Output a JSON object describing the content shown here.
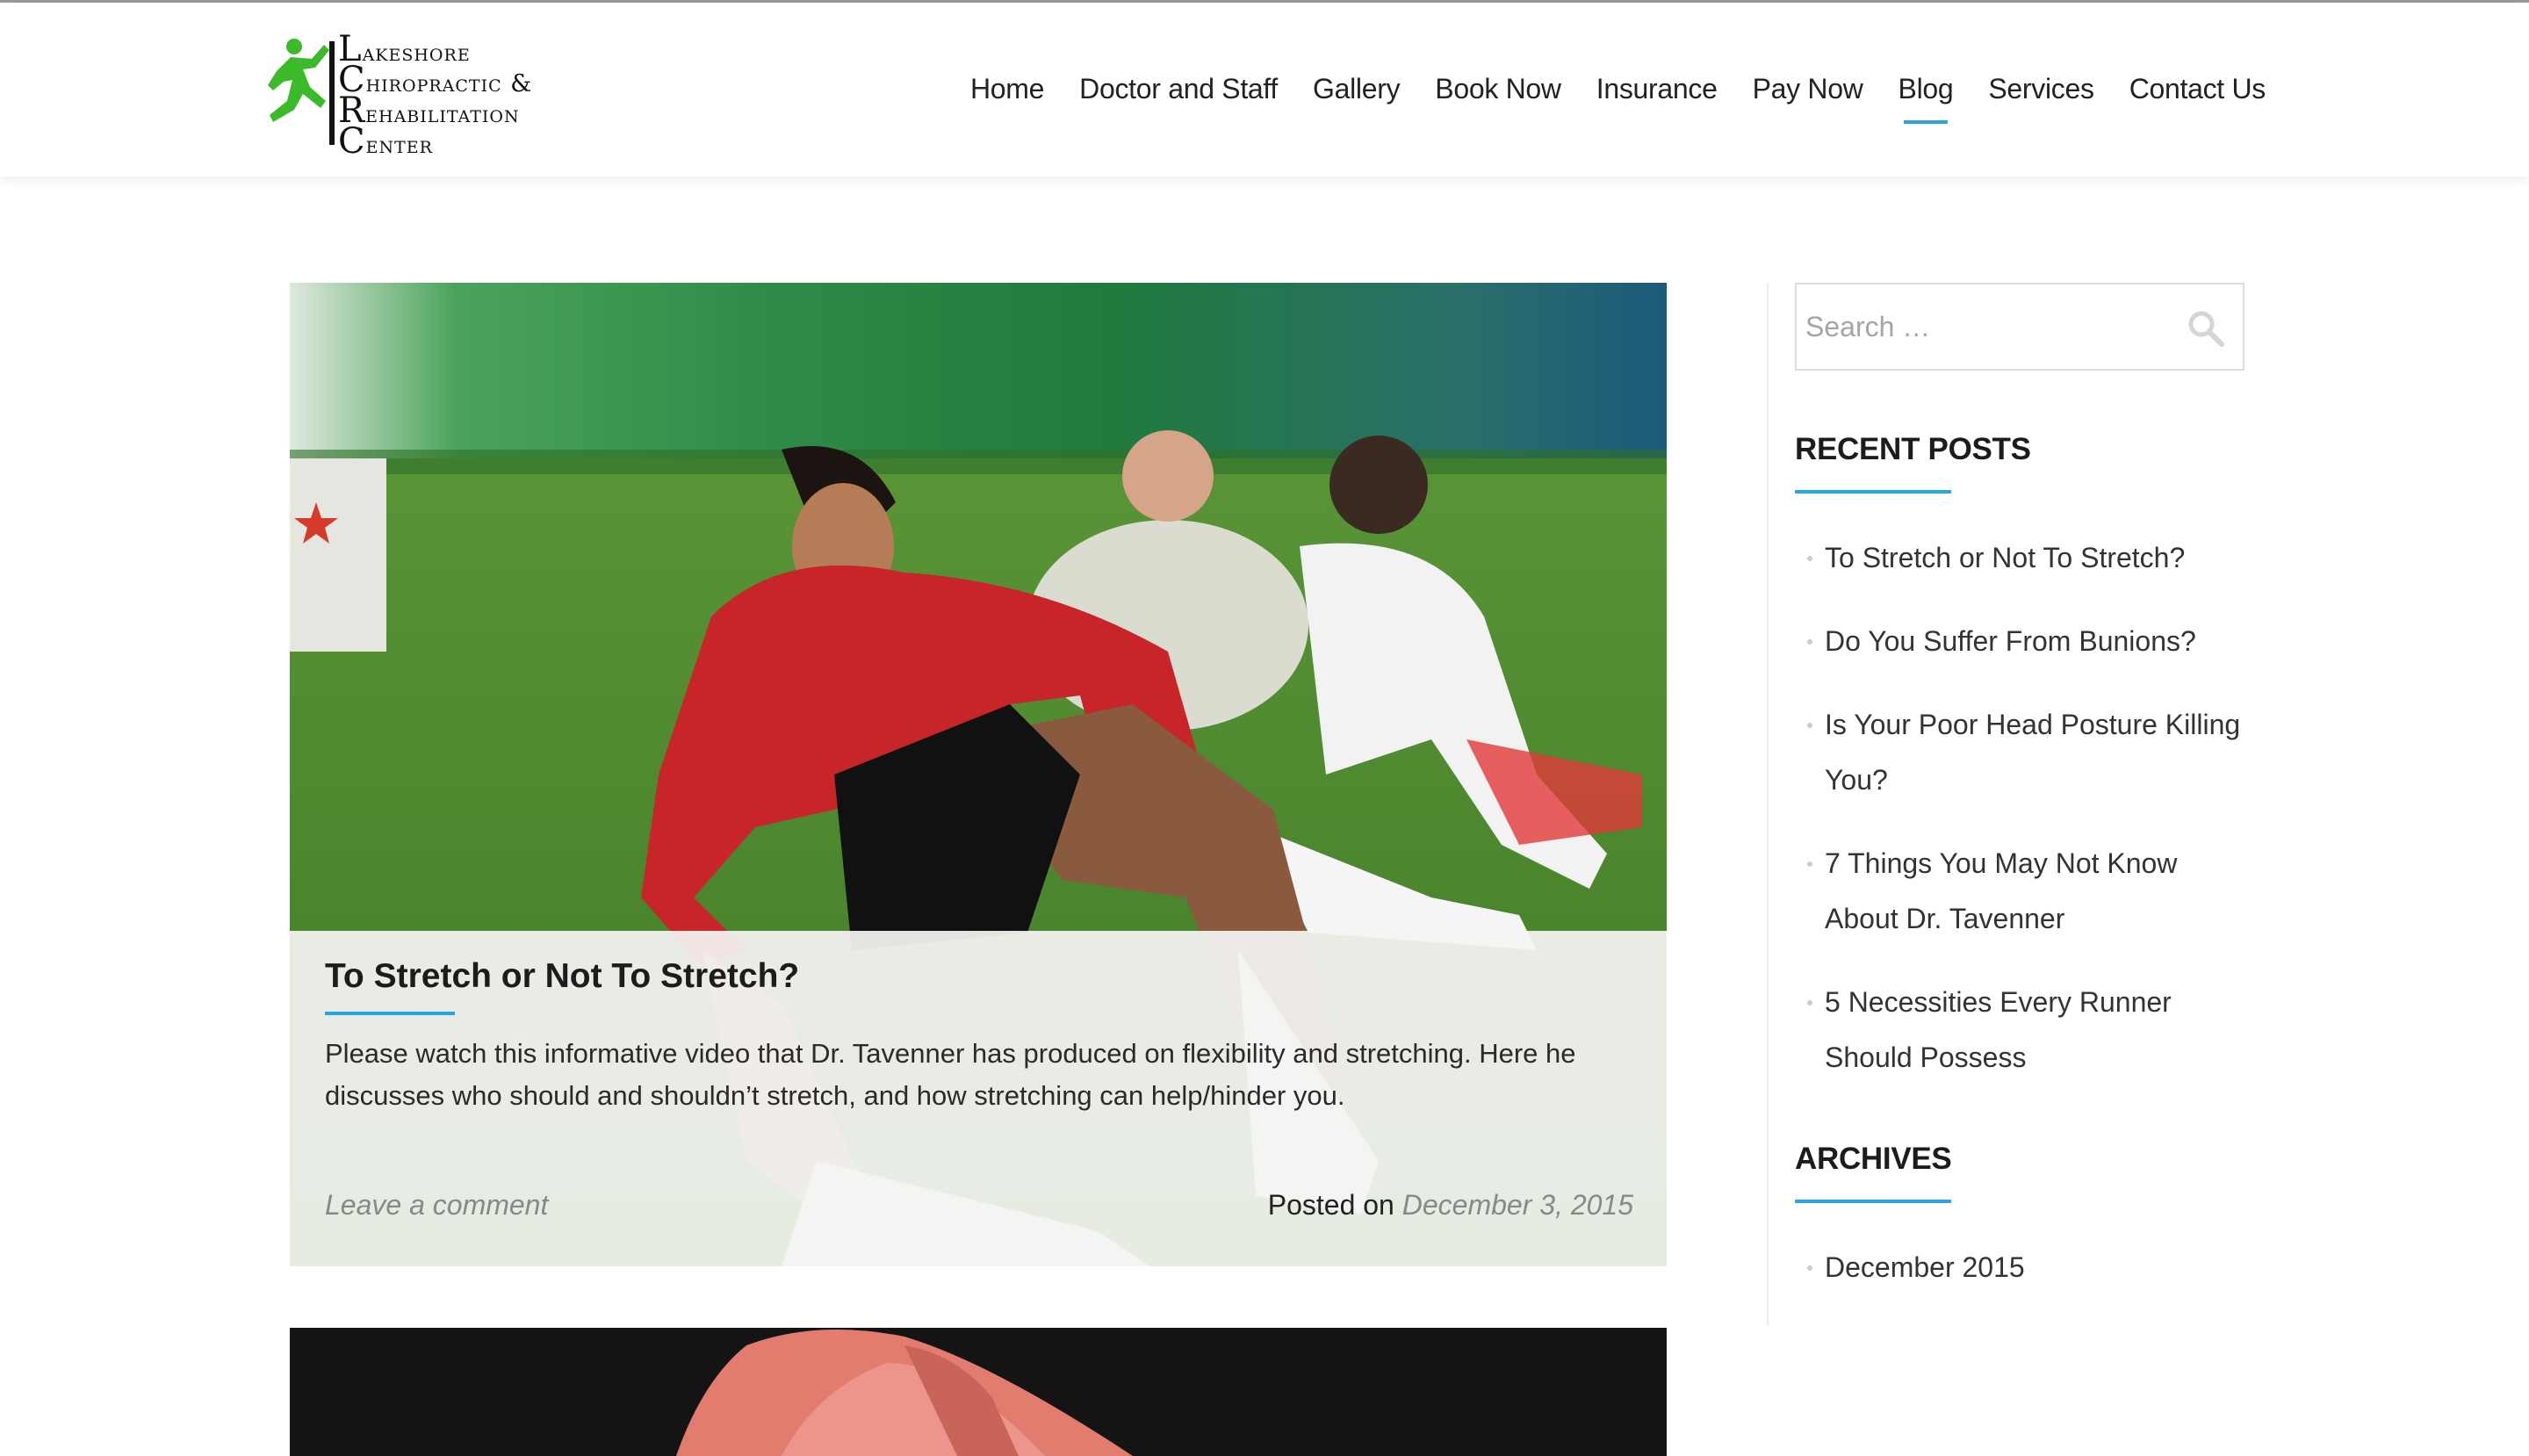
{
  "site": {
    "logo_lines": [
      "Lakeshore",
      "Chiropractic &",
      "Rehabilitation",
      "Center"
    ],
    "logo_icon": "runner-icon",
    "accent_color": "#2aa3df",
    "logo_color": "#3dba2b"
  },
  "nav": {
    "items": [
      {
        "label": "Home"
      },
      {
        "label": "Doctor and Staff"
      },
      {
        "label": "Gallery"
      },
      {
        "label": "Book Now"
      },
      {
        "label": "Insurance"
      },
      {
        "label": "Pay Now"
      },
      {
        "label": "Blog",
        "active": true
      },
      {
        "label": "Services"
      },
      {
        "label": "Contact Us"
      }
    ]
  },
  "post": {
    "title": "To Stretch or Not To Stretch?",
    "excerpt": "Please watch this informative video that Dr. Tavenner has produced on flexibility and stretching.  Here he discusses who should and shouldn’t stretch, and how stretching can help/hinder you.",
    "comment_link": "Leave a comment",
    "posted_prefix": "Posted on",
    "date": "December 3, 2015"
  },
  "sidebar": {
    "search_placeholder": "Search …",
    "recent_title": "RECENT POSTS",
    "recent_posts": [
      "To Stretch or Not To Stretch?",
      "Do You Suffer From Bunions?",
      "Is Your Poor Head Posture Killing You?",
      "7 Things You May Not Know About Dr. Tavenner",
      "5 Necessities Every Runner Should Possess"
    ],
    "archives_title": "ARCHIVES",
    "archives": [
      "December 2015"
    ]
  }
}
